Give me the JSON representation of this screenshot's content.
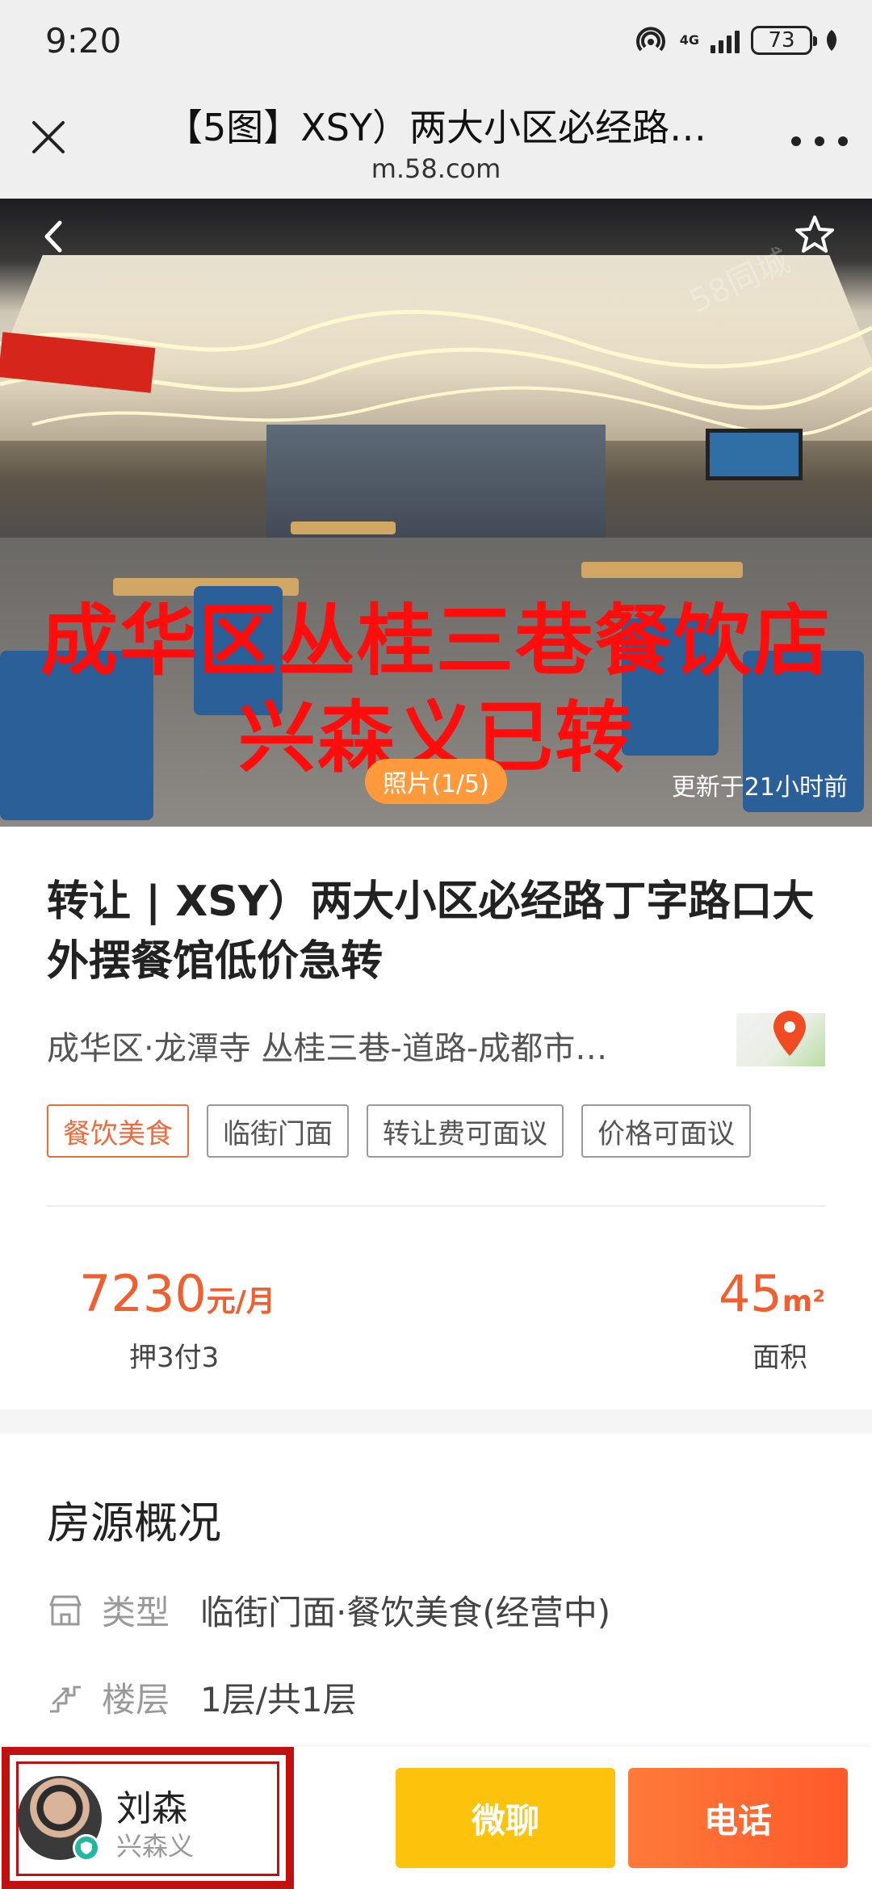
{
  "status_bar": {
    "time": "9:20",
    "network": "4G",
    "battery": "73"
  },
  "browser": {
    "page_title": "【5图】XSY）两大小区必经路…",
    "domain": "m.58.com"
  },
  "photo": {
    "overlay_line1": "成华区丛桂三巷餐饮店",
    "overlay_line2": "兴森义已转",
    "counter": "照片(1/5)",
    "updated": "更新于21小时前",
    "watermark": "58同城"
  },
  "listing": {
    "title": "转让 | XSY）两大小区必经路丁字路口大外摆餐馆低价急转",
    "address": "成华区·龙潭寺 丛桂三巷-道路-成都市…",
    "tags": [
      "餐饮美食",
      "临街门面",
      "转让费可面议",
      "价格可面议"
    ],
    "price_value": "7230",
    "price_unit": "元/月",
    "price_label": "押3付3",
    "area_value": "45",
    "area_unit": "m²",
    "area_label": "面积"
  },
  "overview": {
    "title": "房源概况",
    "type_key": "类型",
    "type_value": "临街门面·餐饮美食(经营中)",
    "floor_key": "楼层",
    "floor_value": "1层/共1层"
  },
  "agent": {
    "name": "刘森",
    "company": "兴森义"
  },
  "actions": {
    "chat_label": "微聊",
    "call_label": "电话"
  },
  "colors": {
    "accent": "#ef5f2f",
    "chat_button": "#fcc20c",
    "call_button": "#ff6a30",
    "highlight_border": "#c20f0f",
    "overlay_text": "#ff0c0c"
  }
}
